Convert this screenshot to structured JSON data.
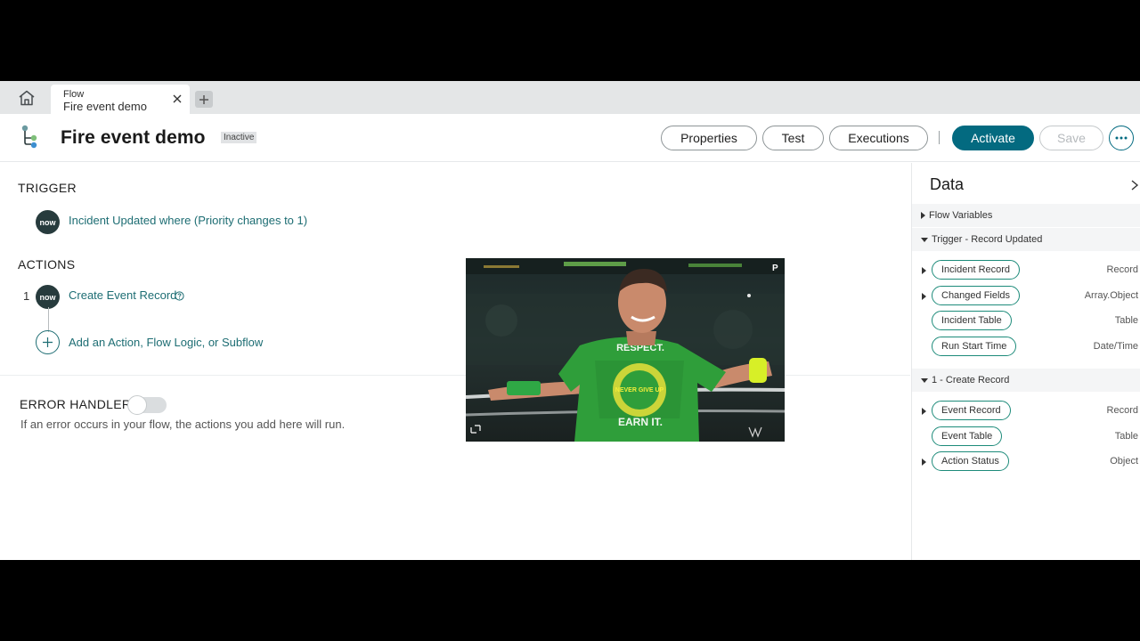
{
  "tabs": {
    "active": {
      "type": "Flow",
      "name": "Fire event demo"
    }
  },
  "header": {
    "title": "Fire event demo",
    "status": "Inactive",
    "buttons": {
      "properties": "Properties",
      "test": "Test",
      "executions": "Executions",
      "activate": "Activate",
      "save": "Save"
    }
  },
  "canvas": {
    "trigger_label": "TRIGGER",
    "trigger": {
      "badge": "now",
      "text": "Incident Updated where (Priority changes to 1)"
    },
    "actions_label": "ACTIONS",
    "actions": [
      {
        "number": "1",
        "badge": "now",
        "text": "Create Event Record"
      }
    ],
    "add_action": "Add an Action, Flow Logic, or Subflow",
    "error_handler": {
      "label": "ERROR HANDLER",
      "enabled": false,
      "help": "If an error occurs in your flow, the actions you add here will run."
    }
  },
  "video_overlay": {
    "shirt_top": "RESPECT.",
    "shirt_mid": "NEVER GIVE UP",
    "shirt_bottom": "EARN IT."
  },
  "data_panel": {
    "title": "Data",
    "groups": [
      {
        "label": "Flow Variables",
        "expanded": false,
        "items": []
      },
      {
        "label": "Trigger - Record Updated",
        "expanded": true,
        "items": [
          {
            "name": "Incident Record",
            "type": "Record",
            "expandable": true
          },
          {
            "name": "Changed Fields",
            "type": "Array.Object",
            "expandable": true
          },
          {
            "name": "Incident Table",
            "type": "Table",
            "expandable": false
          },
          {
            "name": "Run Start Time",
            "type": "Date/Time",
            "expandable": false
          }
        ]
      },
      {
        "label": "1 - Create Record",
        "expanded": true,
        "items": [
          {
            "name": "Event Record",
            "type": "Record",
            "expandable": true
          },
          {
            "name": "Event Table",
            "type": "Table",
            "expandable": false
          },
          {
            "name": "Action Status",
            "type": "Object",
            "expandable": true
          }
        ]
      }
    ]
  },
  "colors": {
    "accent": "#036a80",
    "link": "#1d6d73",
    "pill_border": "#1d8b7a",
    "now_badge": "#273b3d"
  }
}
